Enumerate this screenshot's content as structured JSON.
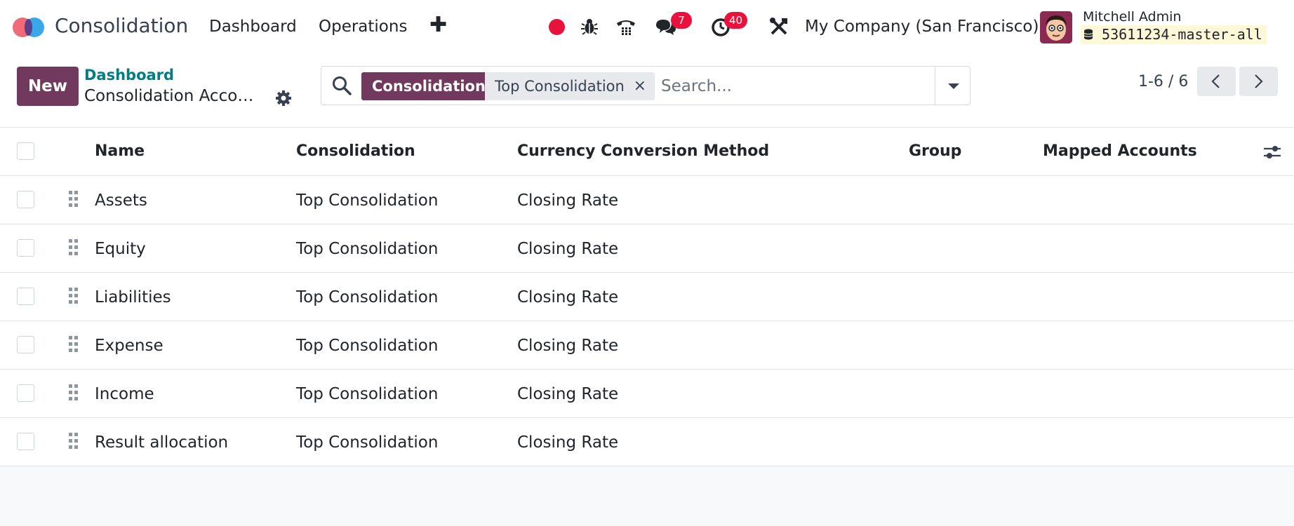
{
  "navbar": {
    "app_name": "Consolidation",
    "menu": [
      "Dashboard",
      "Operations"
    ],
    "plus_label": "✚",
    "messages_badge": "7",
    "activities_badge": "40",
    "company": "My Company (San Francisco)",
    "user_name": "Mitchell Admin",
    "database": "53611234-master-all",
    "icons": [
      "record-icon",
      "bug-icon",
      "phone-icon",
      "chat-icon",
      "clock-icon",
      "tools-icon",
      "database-icon"
    ],
    "colors": {
      "record": "#e8123c",
      "badge": "#e8123c",
      "brand": "#71395d"
    }
  },
  "control_panel": {
    "new_label": "New",
    "breadcrumb_parent": "Dashboard",
    "breadcrumb_current": "Consolidation Accounts",
    "search": {
      "facet_label": "Consolidation",
      "facet_value": "Top Consolidation",
      "facet_close": "×",
      "placeholder": "Search..."
    },
    "pager": {
      "value": "1-6 / 6"
    }
  },
  "table": {
    "columns": [
      "Name",
      "Consolidation",
      "Currency Conversion Method",
      "Group",
      "Mapped Accounts"
    ],
    "rows": [
      {
        "name": "Assets",
        "consolidation": "Top Consolidation",
        "method": "Closing Rate",
        "group": "",
        "mapped": ""
      },
      {
        "name": "Equity",
        "consolidation": "Top Consolidation",
        "method": "Closing Rate",
        "group": "",
        "mapped": ""
      },
      {
        "name": "Liabilities",
        "consolidation": "Top Consolidation",
        "method": "Closing Rate",
        "group": "",
        "mapped": ""
      },
      {
        "name": "Expense",
        "consolidation": "Top Consolidation",
        "method": "Closing Rate",
        "group": "",
        "mapped": ""
      },
      {
        "name": "Income",
        "consolidation": "Top Consolidation",
        "method": "Closing Rate",
        "group": "",
        "mapped": ""
      },
      {
        "name": "Result allocation",
        "consolidation": "Top Consolidation",
        "method": "Closing Rate",
        "group": "",
        "mapped": ""
      }
    ]
  }
}
